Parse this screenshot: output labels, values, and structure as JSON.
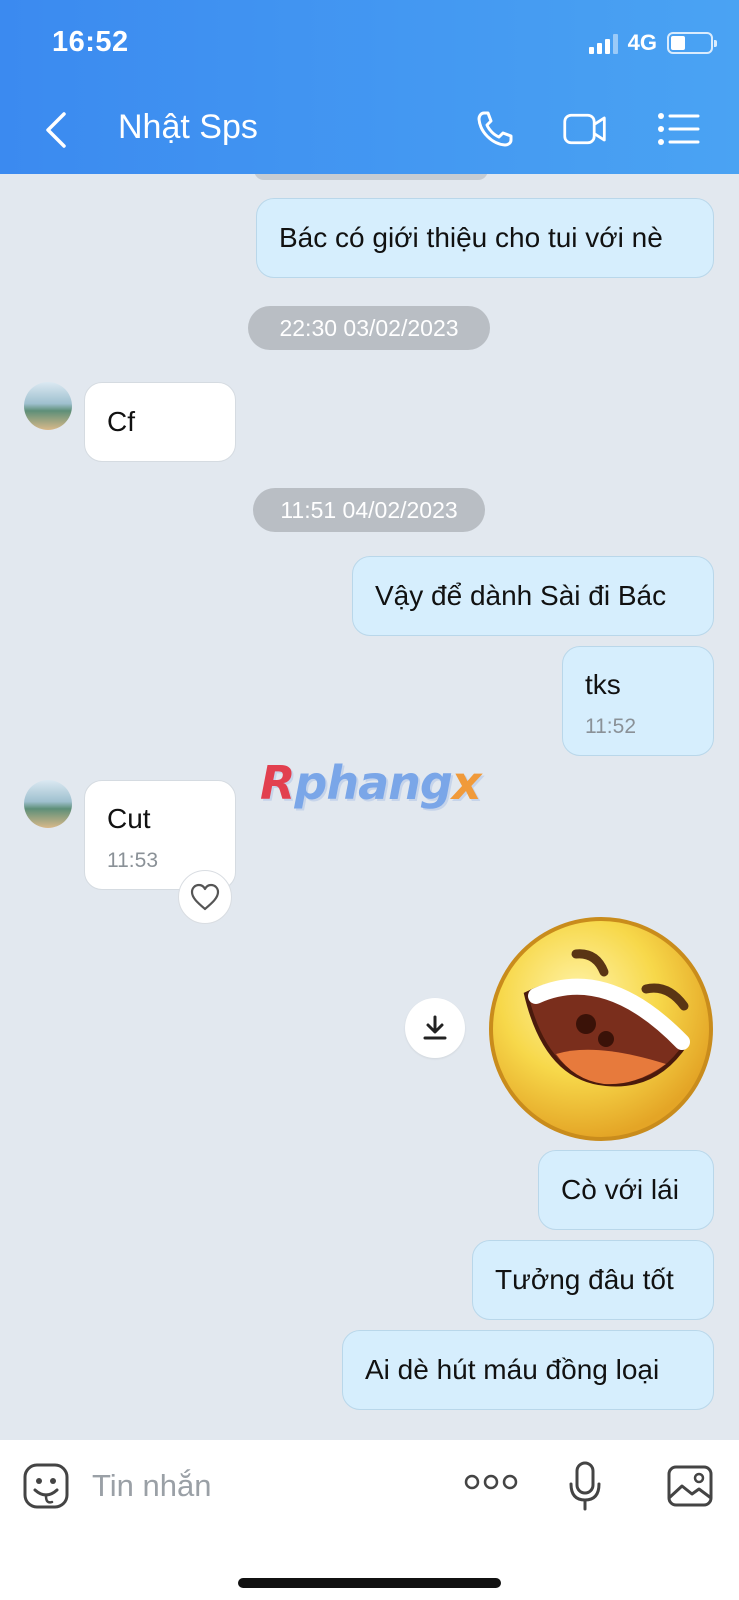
{
  "status_bar": {
    "time": "16:52",
    "network": "4G"
  },
  "header": {
    "title": "Nhật Sps",
    "icons": [
      "chevron-left-icon",
      "phone-icon",
      "video-camera-icon",
      "list-menu-icon"
    ]
  },
  "colors": {
    "header_start": "#3b8af0",
    "header_end": "#4aa3f3",
    "outgoing_bubble": "#d6eefd",
    "incoming_bubble": "#ffffff",
    "background": "#e2e8ef"
  },
  "messages": [
    {
      "type": "outgoing",
      "text": "Bác có giới thiệu cho tui với nè"
    },
    {
      "type": "timestamp",
      "text": "22:30 03/02/2023"
    },
    {
      "type": "incoming",
      "text": "Cf"
    },
    {
      "type": "timestamp",
      "text": "11:51 04/02/2023"
    },
    {
      "type": "outgoing",
      "text": "Vậy để dành Sài đi Bác"
    },
    {
      "type": "outgoing",
      "text": "tks",
      "time": "11:52"
    },
    {
      "type": "incoming",
      "text": "Cut",
      "time": "11:53"
    },
    {
      "type": "sticker",
      "icon": "laughing-face-sticker"
    },
    {
      "type": "outgoing",
      "text": "Cò với lái"
    },
    {
      "type": "outgoing",
      "text": "Tưởng đâu tốt"
    },
    {
      "type": "outgoing",
      "text": "Ai dè hút máu đồng loại"
    }
  ],
  "watermark": {
    "first": "R",
    "middle": "phang",
    "last": "x"
  },
  "composer": {
    "placeholder": "Tin nhắn",
    "icons": [
      "emoji-icon",
      "more-icon",
      "microphone-icon",
      "image-icon"
    ]
  }
}
